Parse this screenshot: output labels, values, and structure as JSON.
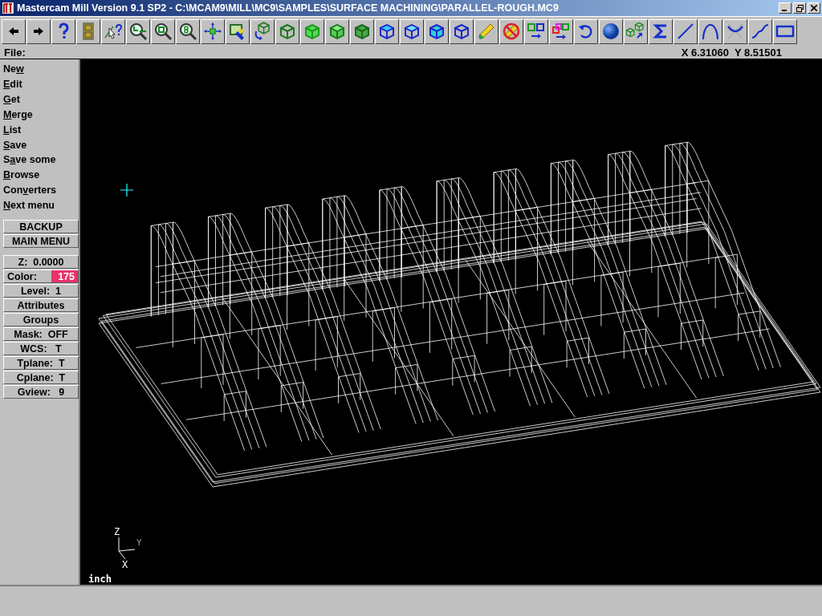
{
  "window": {
    "title": "Mastercam Mill Version 9.1 SP2 - C:\\MCAM9\\MILL\\MC9\\SAMPLES\\SURFACE MACHINING\\PARALLEL-ROUGH.MC9"
  },
  "prompt": {
    "label": "File:",
    "coordinates": "X 6.31060  Y 8.51501"
  },
  "menu": {
    "items": [
      {
        "before": "Ne",
        "key": "w"
      },
      {
        "key": "E",
        "after": "dit"
      },
      {
        "key": "G",
        "after": "et"
      },
      {
        "key": "M",
        "after": "erge"
      },
      {
        "key": "L",
        "after": "ist"
      },
      {
        "key": "S",
        "after": "ave"
      },
      {
        "before": "S",
        "key": "a",
        "after": "ve some"
      },
      {
        "key": "B",
        "after": "rowse"
      },
      {
        "before": "Con",
        "key": "v",
        "after": "erters"
      },
      {
        "key": "N",
        "after": "ext menu"
      }
    ],
    "buttons": [
      "BACKUP",
      "MAIN MENU"
    ]
  },
  "settings": [
    {
      "kind": "plain",
      "label": "Z:  0.0000"
    },
    {
      "kind": "swatch",
      "label": "Color:",
      "value": "175",
      "color": "#e8336a"
    },
    {
      "kind": "plain",
      "label": "Level:  1"
    },
    {
      "kind": "plain",
      "label": "Attributes"
    },
    {
      "kind": "plain",
      "label": "Groups"
    },
    {
      "kind": "plain",
      "label": "Mask:  OFF"
    },
    {
      "kind": "plain",
      "label": "WCS:   T"
    },
    {
      "kind": "plain",
      "label": "Tplane:  T"
    },
    {
      "kind": "plain",
      "label": "Cplane:  T"
    },
    {
      "kind": "plain",
      "label": "Gview:   9"
    }
  ],
  "viewport": {
    "units": "inch",
    "axes": {
      "z": "Z",
      "y": "Y",
      "x": "X"
    }
  }
}
